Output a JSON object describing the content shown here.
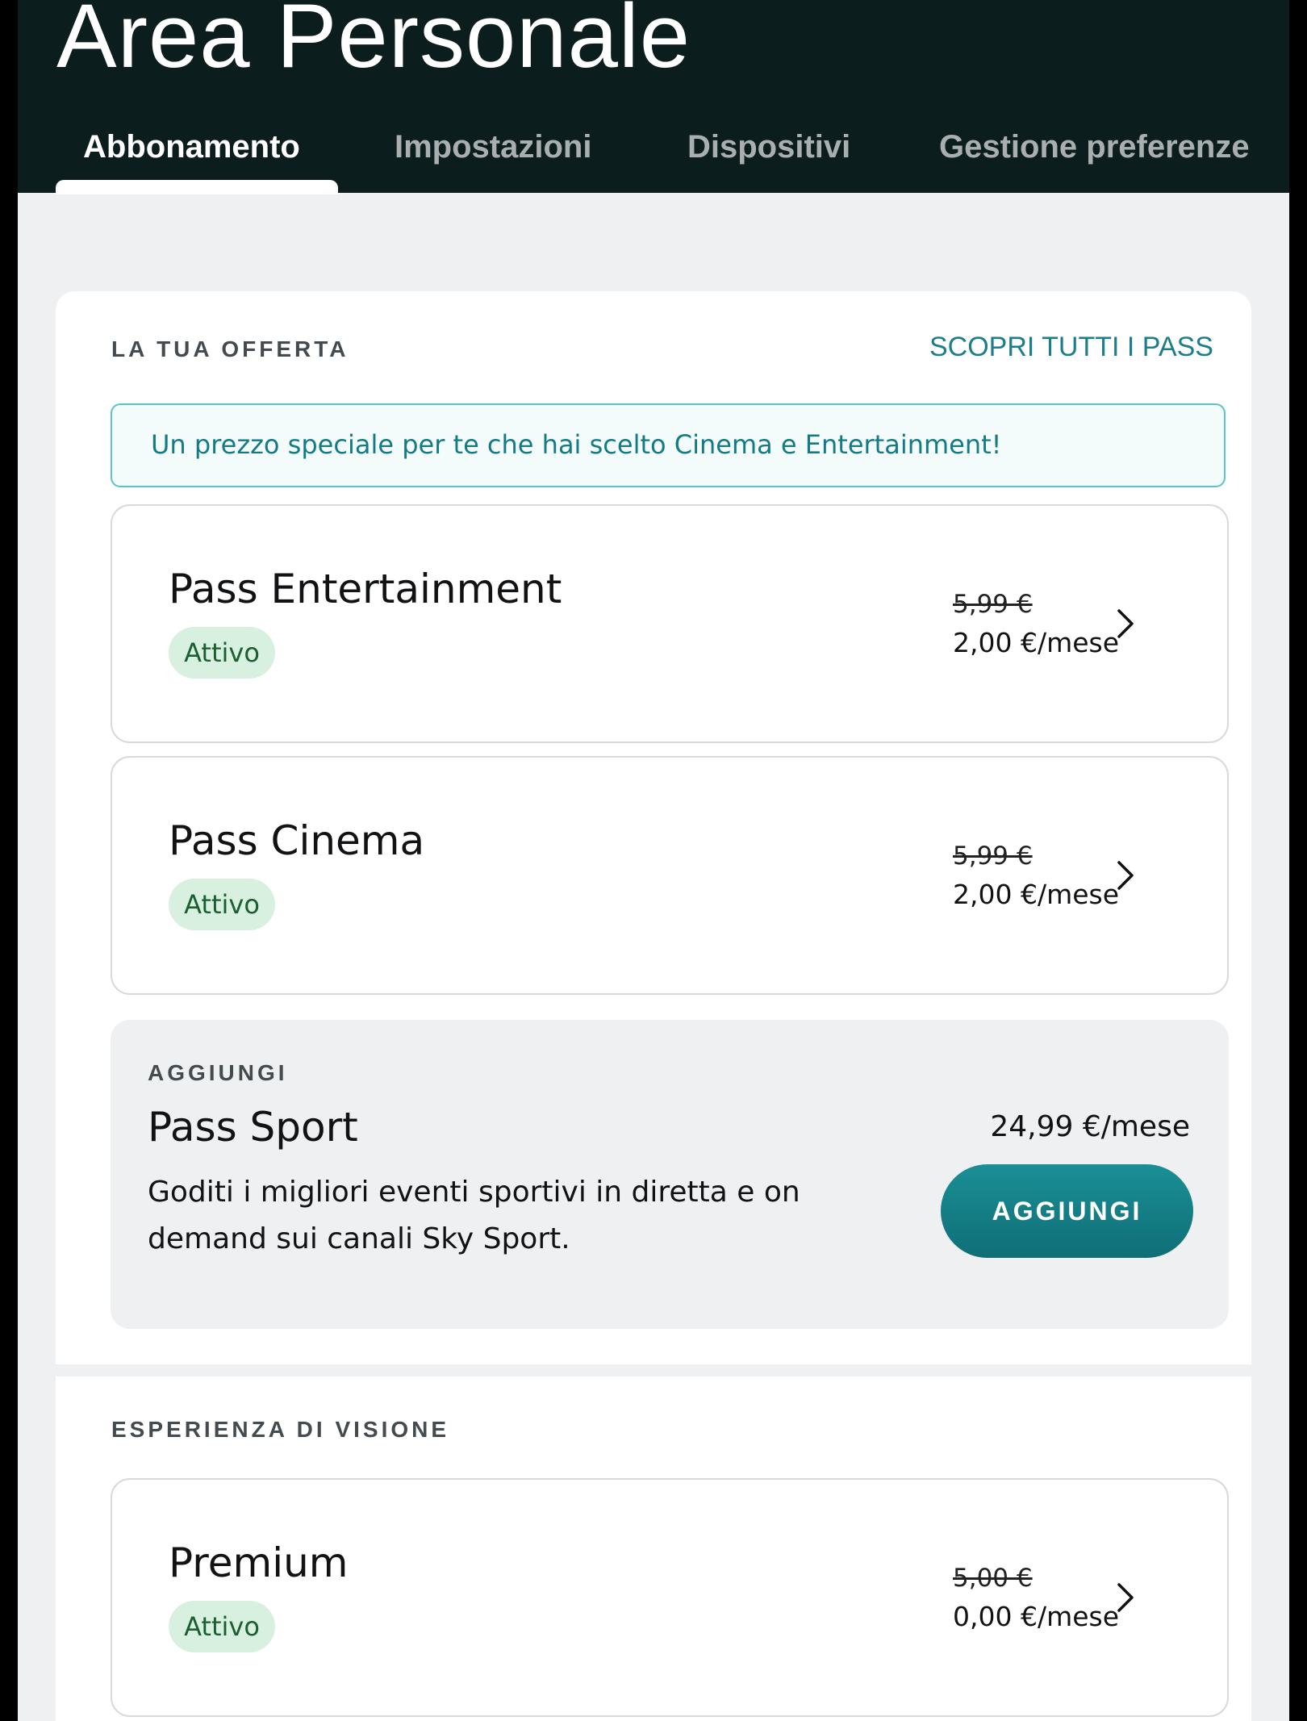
{
  "header": {
    "title": "Area Personale",
    "tabs": [
      {
        "label": "Abbonamento",
        "active": true
      },
      {
        "label": "Impostazioni",
        "active": false
      },
      {
        "label": "Dispositivi",
        "active": false
      },
      {
        "label": "Gestione preferenze",
        "active": false
      }
    ]
  },
  "offer": {
    "section_label": "LA TUA OFFERTA",
    "discover_link": "SCOPRI TUTTI I PASS",
    "promo_text": "Un prezzo speciale per te che hai scelto Cinema e Entertainment!",
    "passes": [
      {
        "name": "Pass Entertainment",
        "status": "Attivo",
        "old_price": "5,99 €",
        "price": "2,00 €/mese"
      },
      {
        "name": "Pass Cinema",
        "status": "Attivo",
        "old_price": "5,99 €",
        "price": "2,00 €/mese"
      }
    ],
    "addon": {
      "label": "AGGIUNGI",
      "name": "Pass Sport",
      "price": "24,99 €/mese",
      "description": "Goditi i migliori eventi sportivi in diretta e on demand sui canali Sky Sport.",
      "button_label": "AGGIUNGI"
    }
  },
  "viewing": {
    "section_label": "ESPERIENZA DI VISIONE",
    "items": [
      {
        "name": "Premium",
        "status": "Attivo",
        "old_price": "5,00 €",
        "price": "0,00 €/mese"
      }
    ]
  },
  "colors": {
    "header_bg": "#0c1d1d",
    "accent": "#1d7d8a",
    "badge_bg": "#d8f0df",
    "button_bg": "#12808a"
  }
}
